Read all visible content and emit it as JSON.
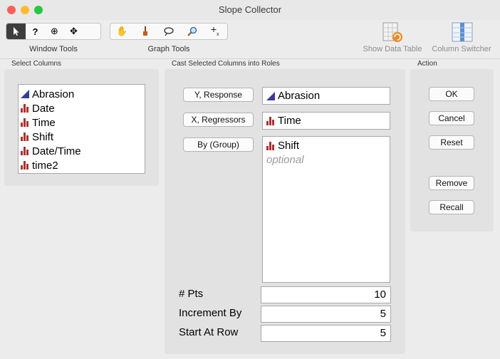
{
  "window": {
    "title": "Slope Collector"
  },
  "toolbar": {
    "window_tools_label": "Window Tools",
    "graph_tools_label": "Graph Tools",
    "show_data_table_label": "Show Data Table",
    "column_switcher_label": "Column Switcher",
    "window_tools": [
      {
        "icon": "arrow-icon",
        "glyph": "▲"
      },
      {
        "icon": "help-icon",
        "glyph": "?"
      },
      {
        "icon": "crosshair-icon",
        "glyph": "⊕"
      },
      {
        "icon": "move-icon",
        "glyph": "✥"
      }
    ],
    "graph_tools": [
      {
        "icon": "hand-icon",
        "glyph": "✋"
      },
      {
        "icon": "brush-icon",
        "glyph": "🖌"
      },
      {
        "icon": "lasso-icon",
        "glyph": "➰"
      },
      {
        "icon": "magnifier-icon",
        "glyph": "🔍"
      },
      {
        "icon": "annotate-icon",
        "glyph": "+"
      }
    ]
  },
  "select_columns": {
    "label": "Select Columns",
    "items": [
      {
        "name": "Abrasion",
        "type": "continuous"
      },
      {
        "name": "Date",
        "type": "nominal"
      },
      {
        "name": "Time",
        "type": "nominal"
      },
      {
        "name": "Shift",
        "type": "nominal"
      },
      {
        "name": "Date/Time",
        "type": "nominal"
      },
      {
        "name": "time2",
        "type": "nominal"
      }
    ]
  },
  "cast": {
    "label": "Cast Selected Columns into Roles",
    "y_response_label": "Y, Response",
    "y_response_value": "Abrasion",
    "x_regressors_label": "X, Regressors",
    "x_regressors_value": "Time",
    "by_group_label": "By (Group)",
    "by_group_value": "Shift",
    "by_group_placeholder": "optional"
  },
  "options": {
    "pts_label": "# Pts",
    "pts_value": "10",
    "increment_label": "Increment By",
    "increment_value": "5",
    "start_label": "Start At Row",
    "start_value": "5"
  },
  "action": {
    "label": "Action",
    "ok": "OK",
    "cancel": "Cancel",
    "reset": "Reset",
    "remove": "Remove",
    "recall": "Recall"
  },
  "colors": {
    "continuous_icon": "#3b3b9a",
    "nominal_icon": "#b03030",
    "close": "#fe5f57",
    "minimize": "#febc2e",
    "zoom": "#28c840"
  }
}
